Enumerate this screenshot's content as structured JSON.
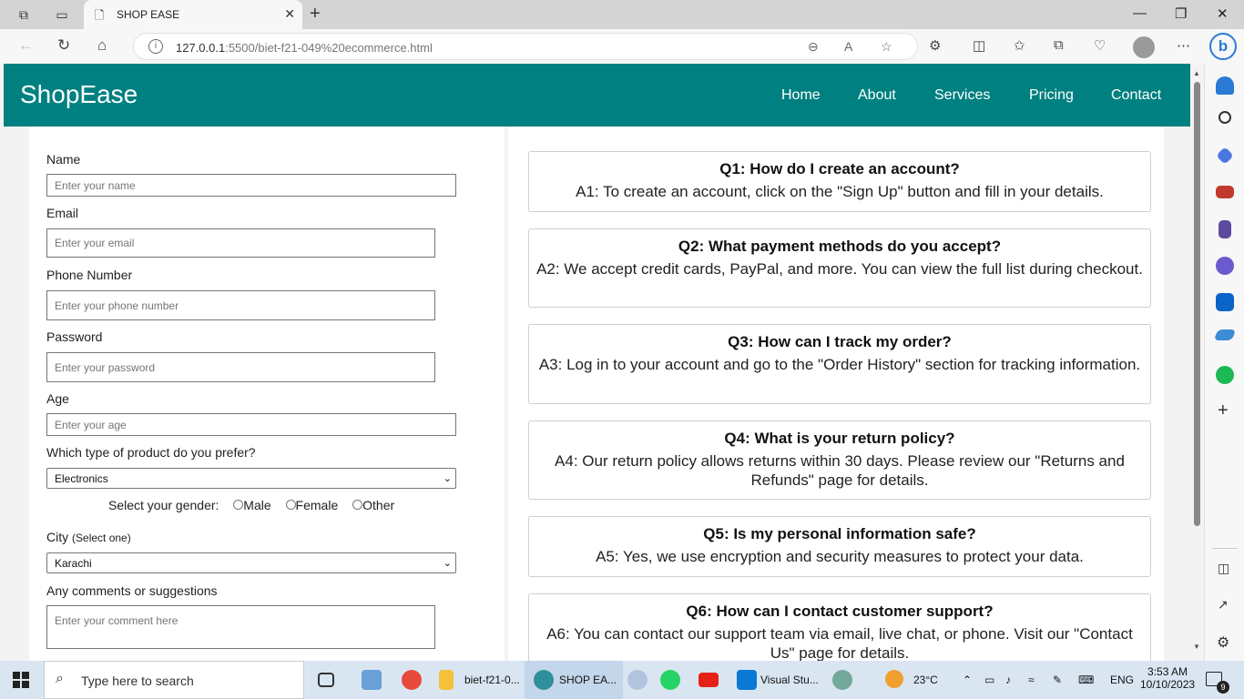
{
  "browser": {
    "tab_title": "SHOP EASE",
    "url_host": "127.0.0.1",
    "url_rest": ":5500/biet-f21-049%20ecommerce.html"
  },
  "site": {
    "brand": "ShopEase",
    "nav": [
      "Home",
      "About",
      "Services",
      "Pricing",
      "Contact"
    ]
  },
  "form": {
    "name_label": "Name",
    "name_placeholder": "Enter your name",
    "email_label": "Email",
    "email_placeholder": "Enter your email",
    "phone_label": "Phone Number",
    "phone_placeholder": "Enter your phone number",
    "password_label": "Password",
    "password_placeholder": "Enter your password",
    "age_label": "Age",
    "age_placeholder": "Enter your age",
    "product_label": "Which type of product do you prefer?",
    "product_value": "Electronics",
    "gender_label": "Select your gender:",
    "gender_options": [
      "Male",
      "Female",
      "Other"
    ],
    "city_label": "City",
    "city_hint": "(Select one)",
    "city_value": "Karachi",
    "comments_label": "Any comments or suggestions",
    "comments_placeholder": "Enter your comment here"
  },
  "faq": [
    {
      "q": "Q1: How do I create an account?",
      "a": "A1: To create an account, click on the \"Sign Up\" button and fill in your details."
    },
    {
      "q": "Q2: What payment methods do you accept?",
      "a": "A2: We accept credit cards, PayPal, and more. You can view the full list during checkout."
    },
    {
      "q": "Q3: How can I track my order?",
      "a": "A3: Log in to your account and go to the \"Order History\" section for tracking information."
    },
    {
      "q": "Q4: What is your return policy?",
      "a": "A4: Our return policy allows returns within 30 days. Please review our \"Returns and Refunds\" page for details."
    },
    {
      "q": "Q5: Is my personal information safe?",
      "a": "A5: Yes, we use encryption and security measures to protect your data."
    },
    {
      "q": "Q6: How can I contact customer support?",
      "a": "A6: You can contact our support team via email, live chat, or phone. Visit our \"Contact Us\" page for details."
    }
  ],
  "taskbar": {
    "search_placeholder": "Type here to search",
    "app1_label": "biet-f21-0...",
    "app2_label": "SHOP EA...",
    "app3_label": "Visual Stu...",
    "weather": "23°C",
    "lang": "ENG",
    "time": "3:53 AM",
    "date": "10/10/2023",
    "notifications": "9"
  },
  "colors": {
    "header": "#008080",
    "accent": "#2a7ad6"
  }
}
